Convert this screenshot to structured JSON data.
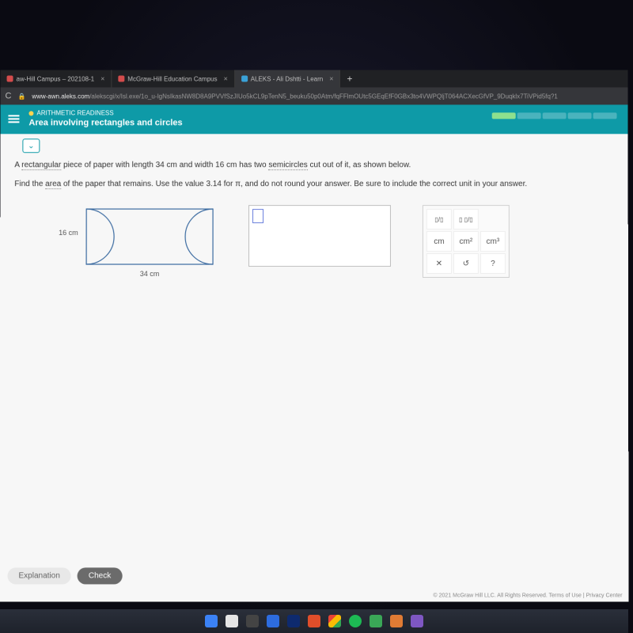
{
  "browser": {
    "tabs": [
      {
        "label": "aw-Hill Campus – 202108-1",
        "fav": "#d34c4c"
      },
      {
        "label": "McGraw-Hill Education Campus",
        "fav": "#d34c4c"
      },
      {
        "label": "ALEKS - Ali Dshtti - Learn",
        "fav": "#3aa2d8",
        "active": true
      }
    ],
    "url_host": "www-awn.aleks.com",
    "url_path": "/alekscgi/x/Isl.exe/1o_u-IgNsIkasNW8D8A9PVVfSzJIUo5kCL9pTenN5_beuku50p0Atm/fqFFlmOUtc5GEqEfF0GBx3to4VWPQljT064ACXecGfVP_9Duqklx7TiVPid5fq?1"
  },
  "header": {
    "module": "ARITHMETIC READINESS",
    "topic": "Area involving rectangles and circles"
  },
  "question": {
    "line1_a": "A ",
    "line1_b": "rectangular",
    "line1_c": " piece of paper with length 34 cm and width 16 cm has two ",
    "line1_d": "semicircles",
    "line1_e": " cut out of it, as shown below.",
    "line2_a": "Find the ",
    "line2_b": "area",
    "line2_c": " of the paper that remains. Use the value 3.14 for π, and do not round your answer. Be sure to include the correct unit in your answer."
  },
  "figure": {
    "width_label": "16 cm",
    "length_label": "34 cm"
  },
  "tools": {
    "frac": "▯/▯",
    "mixed": "▯ ▯/▯",
    "cm": "cm",
    "cm2": "cm²",
    "cm3": "cm³",
    "clear": "✕",
    "undo": "↺",
    "help": "?"
  },
  "buttons": {
    "explanation": "Explanation",
    "check": "Check"
  },
  "footer": {
    "copyright": "© 2021 McGraw Hill LLC. All Rights Reserved.   Terms of Use  |  Privacy Center"
  },
  "taskbar_colors": [
    "#3b82f6",
    "#e5e5e5",
    "#444",
    "#2d6cdf",
    "#0e2a6e",
    "#e04e2a",
    "#f6c445",
    "#f6c445",
    "#1db954",
    "#3aa757",
    "#e07b34",
    "#7e57c2"
  ]
}
